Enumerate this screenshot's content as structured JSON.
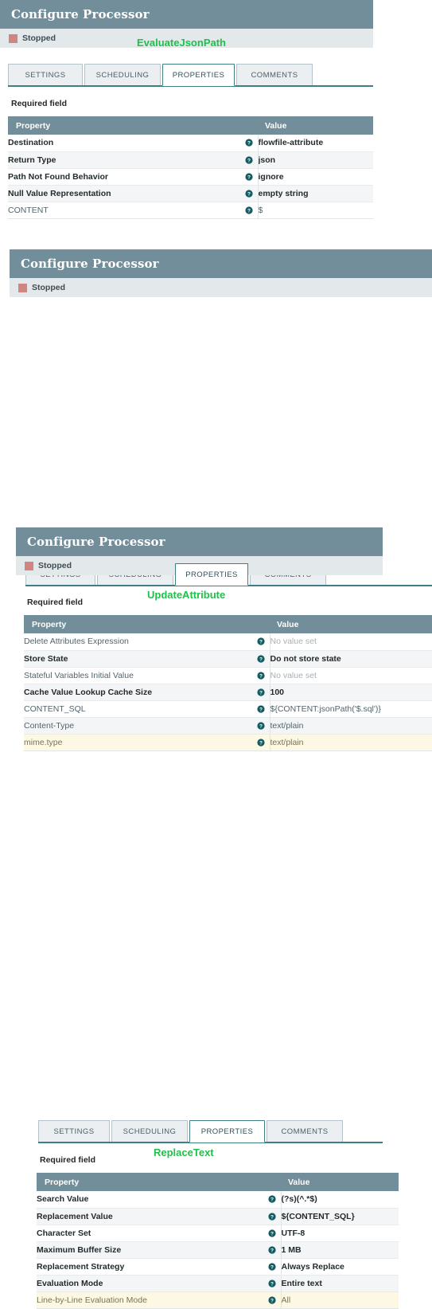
{
  "colors": {
    "header_bg": "#728e9b",
    "status_bg": "#e3e8ea",
    "status_chip": "#d18582",
    "processor_name": "#1fc04b",
    "tab_active_border": "#3f7e82",
    "row_highlight": "#fdf8e4"
  },
  "panels": [
    {
      "id": "evaluatejsonpath",
      "title": "Configure Processor",
      "status": "Stopped",
      "processor_name": "EvaluateJsonPath",
      "required_field_label": "Required field",
      "tabs": [
        {
          "label": "SETTINGS",
          "active": false
        },
        {
          "label": "SCHEDULING",
          "active": false
        },
        {
          "label": "PROPERTIES",
          "active": true
        },
        {
          "label": "COMMENTS",
          "active": false
        }
      ],
      "table": {
        "columns": [
          "Property",
          "Value"
        ],
        "help_icon": "help-circle-icon",
        "rows": [
          {
            "property": "Destination",
            "value": "flowfile-attribute",
            "prop_style": "bold",
            "val_style": "bold",
            "row_style": "even"
          },
          {
            "property": "Return Type",
            "value": "json",
            "prop_style": "bold",
            "val_style": "bold",
            "row_style": "odd"
          },
          {
            "property": "Path Not Found Behavior",
            "value": "ignore",
            "prop_style": "bold",
            "val_style": "bold",
            "row_style": "even"
          },
          {
            "property": "Null Value Representation",
            "value": "empty string",
            "prop_style": "bold",
            "val_style": "bold",
            "row_style": "odd"
          },
          {
            "property": "CONTENT",
            "value": "$",
            "prop_style": "plain",
            "val_style": "plain",
            "row_style": "even"
          }
        ]
      }
    },
    {
      "id": "updateattribute",
      "title": "Configure Processor",
      "status": "Stopped",
      "processor_name": "UpdateAttribute",
      "required_field_label": "Required field",
      "tabs": [
        {
          "label": "SETTINGS",
          "active": false
        },
        {
          "label": "SCHEDULING",
          "active": false
        },
        {
          "label": "PROPERTIES",
          "active": true
        },
        {
          "label": "COMMENTS",
          "active": false
        }
      ],
      "table": {
        "columns": [
          "Property",
          "Value"
        ],
        "help_icon": "help-circle-icon",
        "rows": [
          {
            "property": "Delete Attributes Expression",
            "value": "No value set",
            "prop_style": "plain",
            "val_style": "muted",
            "row_style": "even"
          },
          {
            "property": "Store State",
            "value": "Do not store state",
            "prop_style": "bold",
            "val_style": "bold",
            "row_style": "odd"
          },
          {
            "property": "Stateful Variables Initial Value",
            "value": "No value set",
            "prop_style": "plain",
            "val_style": "muted",
            "row_style": "even"
          },
          {
            "property": "Cache Value Lookup Cache Size",
            "value": "100",
            "prop_style": "bold",
            "val_style": "bold",
            "row_style": "odd"
          },
          {
            "property": "CONTENT_SQL",
            "value": "${CONTENT:jsonPath('$.sql')}",
            "prop_style": "plain",
            "val_style": "plain",
            "row_style": "even"
          },
          {
            "property": "Content-Type",
            "value": "text/plain",
            "prop_style": "plain",
            "val_style": "plain",
            "row_style": "odd"
          },
          {
            "property": "mime.type",
            "value": "text/plain",
            "prop_style": "hlt",
            "val_style": "hlt",
            "row_style": "hl"
          }
        ]
      }
    },
    {
      "id": "replacetext",
      "title": "Configure Processor",
      "status": "Stopped",
      "processor_name": "ReplaceText",
      "required_field_label": "Required field",
      "tabs": [
        {
          "label": "SETTINGS",
          "active": false
        },
        {
          "label": "SCHEDULING",
          "active": false
        },
        {
          "label": "PROPERTIES",
          "active": true
        },
        {
          "label": "COMMENTS",
          "active": false
        }
      ],
      "table": {
        "columns": [
          "Property",
          "Value"
        ],
        "help_icon": "help-circle-icon",
        "rows": [
          {
            "property": "Search Value",
            "value": "(?s)(^.*$)",
            "prop_style": "bold",
            "val_style": "bold",
            "row_style": "even"
          },
          {
            "property": "Replacement Value",
            "value": "${CONTENT_SQL}",
            "prop_style": "bold",
            "val_style": "bold",
            "row_style": "odd"
          },
          {
            "property": "Character Set",
            "value": "UTF-8",
            "prop_style": "bold",
            "val_style": "bold",
            "row_style": "even"
          },
          {
            "property": "Maximum Buffer Size",
            "value": "1 MB",
            "prop_style": "bold",
            "val_style": "bold",
            "row_style": "odd"
          },
          {
            "property": "Replacement Strategy",
            "value": "Always Replace",
            "prop_style": "bold",
            "val_style": "bold",
            "row_style": "even"
          },
          {
            "property": "Evaluation Mode",
            "value": "Entire text",
            "prop_style": "bold",
            "val_style": "bold",
            "row_style": "odd"
          },
          {
            "property": "Line-by-Line Evaluation Mode",
            "value": "All",
            "prop_style": "hlt",
            "val_style": "hlt",
            "row_style": "hl"
          }
        ]
      }
    }
  ]
}
